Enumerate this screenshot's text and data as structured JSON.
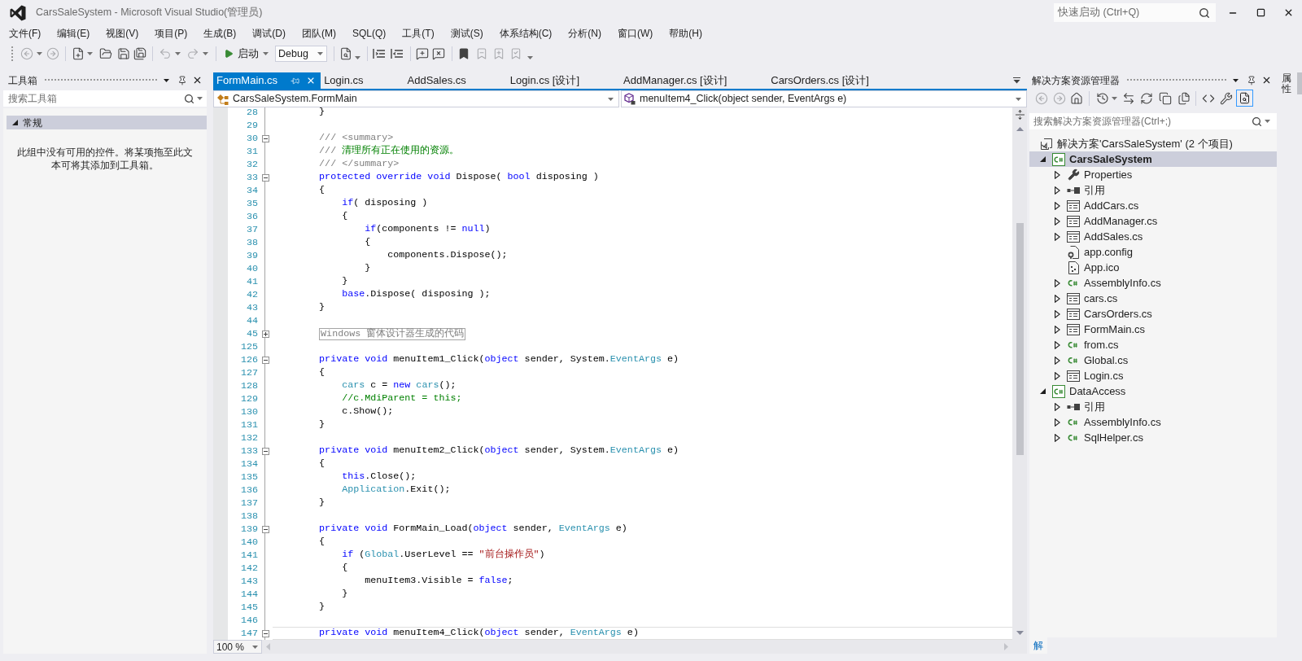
{
  "window": {
    "title": "CarsSaleSystem - Microsoft Visual Studio(管理员)"
  },
  "quick_launch": {
    "placeholder": "快速启动 (Ctrl+Q)"
  },
  "menu": [
    "文件(F)",
    "编辑(E)",
    "视图(V)",
    "项目(P)",
    "生成(B)",
    "调试(D)",
    "团队(M)",
    "SQL(Q)",
    "工具(T)",
    "测试(S)",
    "体系结构(C)",
    "分析(N)",
    "窗口(W)",
    "帮助(H)"
  ],
  "toolbar": {
    "back": {
      "disabled": true
    },
    "forward": {
      "disabled": true
    },
    "undo": {
      "disabled": true
    },
    "redo": {
      "disabled": true
    },
    "start": {
      "label": "启动"
    },
    "configuration": {
      "value": "Debug"
    },
    "previous_bookmark": {
      "disabled": true
    },
    "next_bookmark": {
      "disabled": true
    },
    "clear_bookmarks": {
      "disabled": true
    }
  },
  "toolbox": {
    "title": "工具箱",
    "search": {
      "placeholder": "搜索工具箱"
    },
    "groups": [
      {
        "label": "常规",
        "expanded": true,
        "empty_message": "此组中没有可用的控件。将某项拖至此文本可将其添加到工具箱。"
      }
    ]
  },
  "documents": {
    "tabs": [
      {
        "label": "FormMain.cs",
        "selected": true
      },
      {
        "label": "Login.cs",
        "selected": false
      },
      {
        "label": "AddSales.cs",
        "selected": false
      },
      {
        "label": "Login.cs [设计]",
        "selected": false
      },
      {
        "label": "AddManager.cs [设计]",
        "selected": false
      },
      {
        "label": "CarsOrders.cs [设计]",
        "selected": false
      }
    ],
    "navigation": {
      "type_scope": "CarsSaleSystem.FormMain",
      "member": "menuItem4_Click(object sender, EventArgs e)"
    },
    "editor": {
      "zoom": "100 %",
      "lines": [
        {
          "number": "28",
          "selected": false,
          "tokens": [
            {
              "kind": "plain",
              "text": "        }"
            }
          ]
        },
        {
          "number": "29",
          "selected": false
        },
        {
          "number": "30",
          "selected": false,
          "expanded": true,
          "tokens": [
            {
              "kind": "doc",
              "text": "        /// <summary>"
            }
          ]
        },
        {
          "number": "31",
          "selected": false,
          "tokens": [
            {
              "kind": "doc",
              "text": "        ///"
            },
            {
              "kind": "comment",
              "text": " 清理所有正在使用的资源。"
            }
          ]
        },
        {
          "number": "32",
          "selected": false,
          "tokens": [
            {
              "kind": "doc",
              "text": "        /// </summary>"
            }
          ]
        },
        {
          "number": "33",
          "selected": false,
          "expanded": true,
          "tokens": [
            {
              "kind": "keyword",
              "text": "        protected override void"
            },
            {
              "kind": "plain",
              "text": " Dispose( "
            },
            {
              "kind": "keyword",
              "text": "bool"
            },
            {
              "kind": "plain",
              "text": " disposing )"
            }
          ]
        },
        {
          "number": "34",
          "selected": false,
          "tokens": [
            {
              "kind": "plain",
              "text": "        {"
            }
          ]
        },
        {
          "number": "35",
          "selected": false,
          "tokens": [
            {
              "kind": "keyword",
              "text": "            if"
            },
            {
              "kind": "plain",
              "text": "( disposing )"
            }
          ]
        },
        {
          "number": "36",
          "selected": false,
          "tokens": [
            {
              "kind": "plain",
              "text": "            {"
            }
          ]
        },
        {
          "number": "37",
          "selected": false,
          "tokens": [
            {
              "kind": "keyword",
              "text": "                if"
            },
            {
              "kind": "plain",
              "text": "(components != "
            },
            {
              "kind": "keyword",
              "text": "null"
            },
            {
              "kind": "plain",
              "text": ")"
            }
          ]
        },
        {
          "number": "38",
          "selected": false,
          "tokens": [
            {
              "kind": "plain",
              "text": "                {"
            }
          ]
        },
        {
          "number": "39",
          "selected": false,
          "tokens": [
            {
              "kind": "plain",
              "text": "                    components.Dispose();"
            }
          ]
        },
        {
          "number": "40",
          "selected": false,
          "tokens": [
            {
              "kind": "plain",
              "text": "                }"
            }
          ]
        },
        {
          "number": "41",
          "selected": false,
          "tokens": [
            {
              "kind": "plain",
              "text": "            }"
            }
          ]
        },
        {
          "number": "42",
          "selected": false,
          "tokens": [
            {
              "kind": "keyword",
              "text": "            base"
            },
            {
              "kind": "plain",
              "text": ".Dispose( disposing );"
            }
          ]
        },
        {
          "number": "43",
          "selected": false,
          "tokens": [
            {
              "kind": "plain",
              "text": "        }"
            }
          ]
        },
        {
          "number": "44",
          "selected": false
        },
        {
          "number": "45",
          "selected": false,
          "expanded": false,
          "tokens": [
            {
              "kind": "region",
              "text": "        Windows 窗体设计器生成的代码"
            }
          ]
        },
        {
          "number": "125",
          "selected": false
        },
        {
          "number": "126",
          "selected": false,
          "expanded": true,
          "tokens": [
            {
              "kind": "keyword",
              "text": "        private void"
            },
            {
              "kind": "plain",
              "text": " menuItem1_Click("
            },
            {
              "kind": "keyword",
              "text": "object"
            },
            {
              "kind": "plain",
              "text": " sender, System."
            },
            {
              "kind": "type",
              "text": "EventArgs"
            },
            {
              "kind": "plain",
              "text": " e)"
            }
          ]
        },
        {
          "number": "127",
          "selected": false,
          "tokens": [
            {
              "kind": "plain",
              "text": "        {"
            }
          ]
        },
        {
          "number": "128",
          "selected": false,
          "tokens": [
            {
              "kind": "type",
              "text": "            cars"
            },
            {
              "kind": "plain",
              "text": " c = "
            },
            {
              "kind": "keyword",
              "text": "new"
            },
            {
              "kind": "type",
              "text": " cars"
            },
            {
              "kind": "plain",
              "text": "();"
            }
          ]
        },
        {
          "number": "129",
          "selected": false,
          "tokens": [
            {
              "kind": "comment",
              "text": "            //c.MdiParent = this;"
            }
          ]
        },
        {
          "number": "130",
          "selected": false,
          "tokens": [
            {
              "kind": "plain",
              "text": "            c.Show();"
            }
          ]
        },
        {
          "number": "131",
          "selected": false,
          "tokens": [
            {
              "kind": "plain",
              "text": "        }"
            }
          ]
        },
        {
          "number": "132",
          "selected": false
        },
        {
          "number": "133",
          "selected": false,
          "expanded": true,
          "tokens": [
            {
              "kind": "keyword",
              "text": "        private void"
            },
            {
              "kind": "plain",
              "text": " menuItem2_Click("
            },
            {
              "kind": "keyword",
              "text": "object"
            },
            {
              "kind": "plain",
              "text": " sender, System."
            },
            {
              "kind": "type",
              "text": "EventArgs"
            },
            {
              "kind": "plain",
              "text": " e)"
            }
          ]
        },
        {
          "number": "134",
          "selected": false,
          "tokens": [
            {
              "kind": "plain",
              "text": "        {"
            }
          ]
        },
        {
          "number": "135",
          "selected": false,
          "tokens": [
            {
              "kind": "keyword",
              "text": "            this"
            },
            {
              "kind": "plain",
              "text": ".Close();"
            }
          ]
        },
        {
          "number": "136",
          "selected": false,
          "tokens": [
            {
              "kind": "type",
              "text": "            Application"
            },
            {
              "kind": "plain",
              "text": ".Exit();"
            }
          ]
        },
        {
          "number": "137",
          "selected": false,
          "tokens": [
            {
              "kind": "plain",
              "text": "        }"
            }
          ]
        },
        {
          "number": "138",
          "selected": false
        },
        {
          "number": "139",
          "selected": false,
          "expanded": true,
          "tokens": [
            {
              "kind": "keyword",
              "text": "        private void"
            },
            {
              "kind": "plain",
              "text": " FormMain_Load("
            },
            {
              "kind": "keyword",
              "text": "object"
            },
            {
              "kind": "plain",
              "text": " sender, "
            },
            {
              "kind": "type",
              "text": "EventArgs"
            },
            {
              "kind": "plain",
              "text": " e)"
            }
          ]
        },
        {
          "number": "140",
          "selected": false,
          "tokens": [
            {
              "kind": "plain",
              "text": "        {"
            }
          ]
        },
        {
          "number": "141",
          "selected": false,
          "tokens": [
            {
              "kind": "keyword",
              "text": "            if"
            },
            {
              "kind": "plain",
              "text": " ("
            },
            {
              "kind": "type",
              "text": "Global"
            },
            {
              "kind": "plain",
              "text": ".UserLevel == "
            },
            {
              "kind": "string",
              "text": "\"前台操作员\""
            },
            {
              "kind": "plain",
              "text": ")"
            }
          ]
        },
        {
          "number": "142",
          "selected": false,
          "tokens": [
            {
              "kind": "plain",
              "text": "            {"
            }
          ]
        },
        {
          "number": "143",
          "selected": false,
          "tokens": [
            {
              "kind": "plain",
              "text": "                menuItem3.Visible = "
            },
            {
              "kind": "keyword",
              "text": "false"
            },
            {
              "kind": "plain",
              "text": ";"
            }
          ]
        },
        {
          "number": "144",
          "selected": false,
          "tokens": [
            {
              "kind": "plain",
              "text": "            }"
            }
          ]
        },
        {
          "number": "145",
          "selected": false,
          "tokens": [
            {
              "kind": "plain",
              "text": "        }"
            }
          ]
        },
        {
          "number": "146",
          "selected": false
        },
        {
          "number": "147",
          "selected": true,
          "expanded": true,
          "tokens": [
            {
              "kind": "keyword",
              "text": "        private void"
            },
            {
              "kind": "plain",
              "text": " menuItem4_Click("
            },
            {
              "kind": "keyword",
              "text": "object"
            },
            {
              "kind": "plain",
              "text": " sender, "
            },
            {
              "kind": "type",
              "text": "EventArgs"
            },
            {
              "kind": "plain",
              "text": " e)"
            }
          ]
        }
      ]
    }
  },
  "solution_explorer": {
    "title": "解决方案资源管理器",
    "toolbar": {
      "back": {
        "disabled": true
      },
      "forward": {
        "disabled": true
      },
      "preview": {
        "on": true
      }
    },
    "search": {
      "placeholder": "搜索解决方案资源管理器(Ctrl+;)"
    },
    "tree": [
      {
        "label": "解决方案'CarsSaleSystem' (2 个项目)",
        "kind": "solution",
        "selected": false,
        "children": [
          {
            "label": "CarsSaleSystem",
            "kind": "csharp_project",
            "selected": true,
            "expanded": true,
            "startup": true,
            "children": [
              {
                "label": "Properties",
                "kind": "properties",
                "selected": false,
                "expanded": false
              },
              {
                "label": "引用",
                "kind": "references",
                "selected": false,
                "expanded": false
              },
              {
                "label": "AddCars.cs",
                "kind": "form",
                "selected": false,
                "expanded": false
              },
              {
                "label": "AddManager.cs",
                "kind": "form",
                "selected": false,
                "expanded": false
              },
              {
                "label": "AddSales.cs",
                "kind": "form",
                "selected": false,
                "expanded": false
              },
              {
                "label": "app.config",
                "kind": "config",
                "selected": false
              },
              {
                "label": "App.ico",
                "kind": "icon_file",
                "selected": false
              },
              {
                "label": "AssemblyInfo.cs",
                "kind": "csharp",
                "selected": false,
                "expanded": false
              },
              {
                "label": "cars.cs",
                "kind": "form",
                "selected": false,
                "expanded": false
              },
              {
                "label": "CarsOrders.cs",
                "kind": "form",
                "selected": false,
                "expanded": false
              },
              {
                "label": "FormMain.cs",
                "kind": "form",
                "selected": false,
                "expanded": false
              },
              {
                "label": "from.cs",
                "kind": "csharp",
                "selected": false,
                "expanded": false
              },
              {
                "label": "Global.cs",
                "kind": "csharp",
                "selected": false,
                "expanded": false
              },
              {
                "label": "Login.cs",
                "kind": "form",
                "selected": false,
                "expanded": false
              }
            ]
          },
          {
            "label": "DataAccess",
            "kind": "csharp_project",
            "selected": false,
            "expanded": true,
            "startup": false,
            "children": [
              {
                "label": "引用",
                "kind": "references",
                "selected": false,
                "expanded": false
              },
              {
                "label": "AssemblyInfo.cs",
                "kind": "csharp",
                "selected": false,
                "expanded": false
              },
              {
                "label": "SqlHelper.cs",
                "kind": "csharp",
                "selected": false,
                "expanded": false
              }
            ]
          }
        ]
      }
    ],
    "tabs": [
      {
        "label": "解",
        "selected": true
      }
    ]
  },
  "side_tabs": [
    {
      "label": "属性"
    }
  ]
}
